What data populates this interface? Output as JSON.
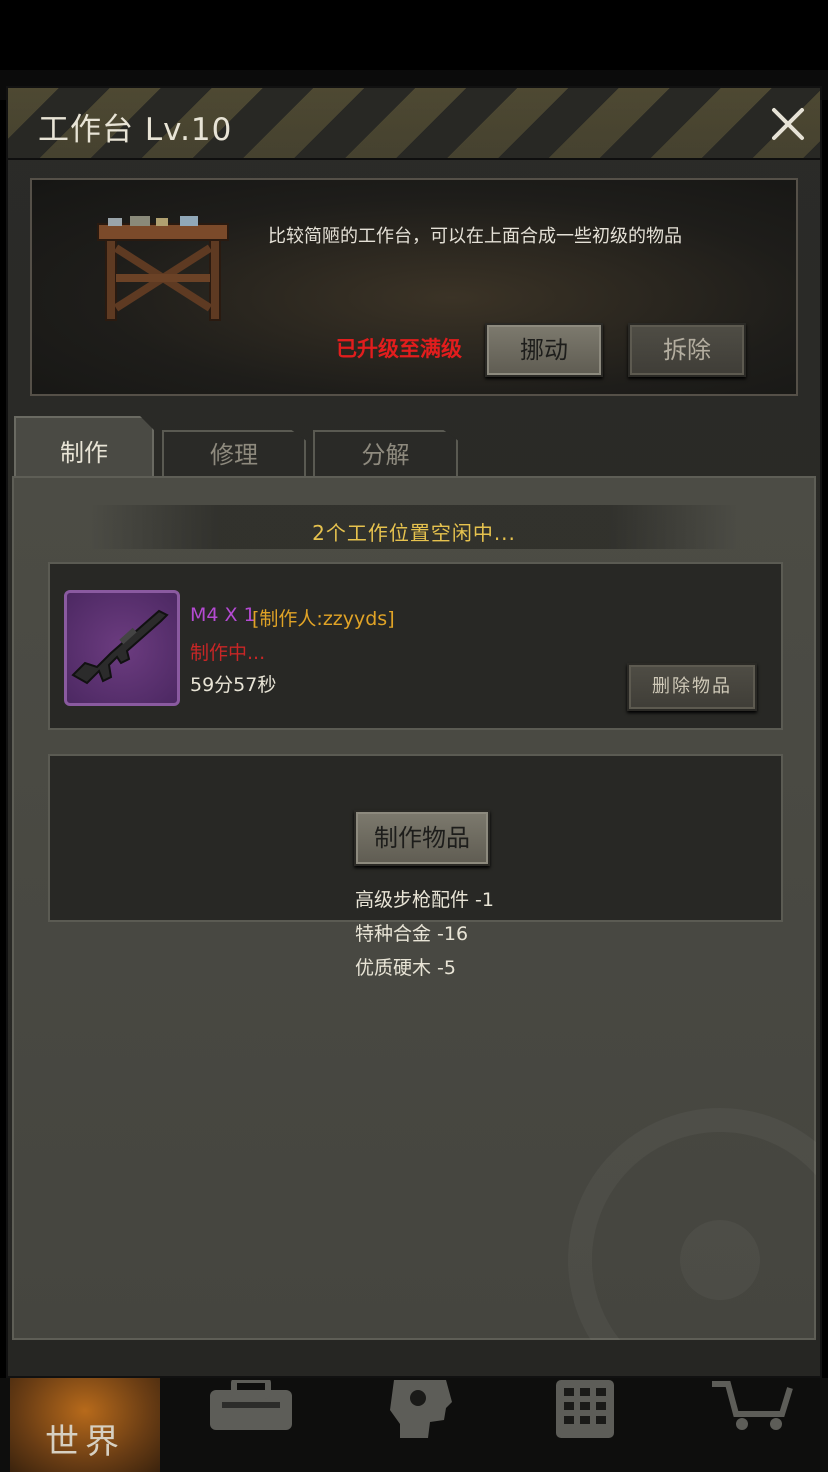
{
  "panel": {
    "title": "工作台 Lv.10",
    "description": "比较简陋的工作台，可以在上面合成一些初级的物品",
    "max_level_text": "已升级至满级",
    "move_label": "挪动",
    "remove_label": "拆除"
  },
  "tabs": [
    {
      "label": "制作",
      "active": true
    },
    {
      "label": "修理",
      "active": false
    },
    {
      "label": "分解",
      "active": false
    }
  ],
  "crafting": {
    "slots_status": "2个工作位置空闲中...",
    "job": {
      "name": "M4 X 1",
      "maker": "[制作人:zzyyds]",
      "status": "制作中...",
      "time_left": "59分57秒",
      "delete_label": "删除物品"
    },
    "craft_label": "制作物品",
    "materials": [
      "高级步枪配件 -1",
      "特种合金 -16",
      "优质硬木 -5"
    ]
  },
  "bottom_nav": {
    "world_label": "世界",
    "icons": [
      "backpack-icon",
      "head-gear-icon",
      "calculator-icon",
      "cart-icon"
    ]
  },
  "colors": {
    "accent_gold": "#e6c24e",
    "rarity_purple": "#b44ad2",
    "warning_red": "#e21d1d"
  }
}
